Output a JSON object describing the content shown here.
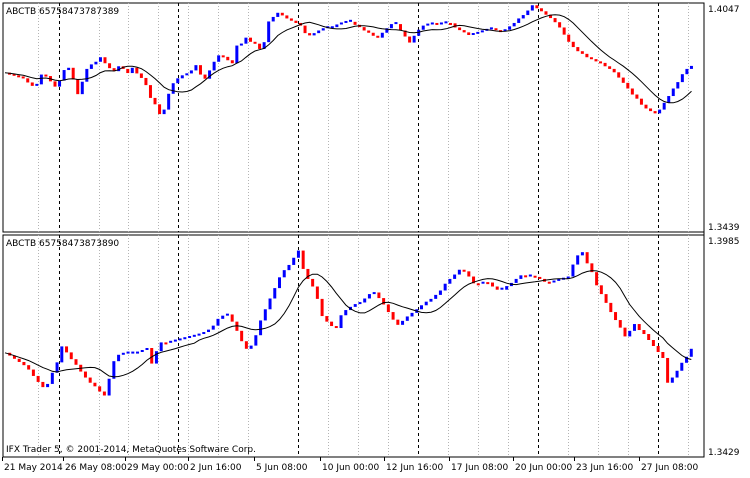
{
  "colors": {
    "up": "#0000ff",
    "down": "#ff0000",
    "line": "#000000",
    "grid": "#b4b4b4",
    "session": "#000000",
    "frame": "#000000",
    "background": "#ffffff"
  },
  "copyright": "IFX Trader 5, © 2001-2014, MetaQuotes Software Corp.",
  "x_axis": {
    "labels": [
      "21 May 2014",
      "26 May 08:00",
      "29 May 00:00",
      "2 Jun 16:00",
      "5 Jun 08:00",
      "10 Jun 00:00",
      "12 Jun 16:00",
      "17 Jun 08:00",
      "20 Jun 00:00",
      "23 Jun 16:00",
      "27 Jun 08:00"
    ]
  },
  "chart_data": [
    {
      "type": "line",
      "symbol": "ABCTB 65758473787389",
      "y_axis": {
        "top_label": "1.4047",
        "bottom_label": "1.3439",
        "ylim": [
          1.3439,
          1.4047
        ]
      },
      "series": [
        {
          "name": "",
          "role": "renko_close",
          "values": [
            1.3862,
            1.3859,
            1.3855,
            1.3852,
            1.3847,
            1.3836,
            1.3827,
            1.3831,
            1.3857,
            1.3853,
            1.3839,
            1.3825,
            1.3841,
            1.3869,
            1.3875,
            1.3844,
            1.3805,
            1.3838,
            1.3872,
            1.3884,
            1.3891,
            1.3903,
            1.3887,
            1.3874,
            1.3866,
            1.3879,
            1.3872,
            1.3861,
            1.3875,
            1.386,
            1.3848,
            1.3829,
            1.3795,
            1.3778,
            1.3752,
            1.3764,
            1.3806,
            1.3834,
            1.3847,
            1.3855,
            1.386,
            1.3868,
            1.3882,
            1.3857,
            1.3846,
            1.3868,
            1.3891,
            1.3908,
            1.3904,
            1.3895,
            1.3887,
            1.3934,
            1.3939,
            1.3955,
            1.3944,
            1.3939,
            1.3925,
            1.3943,
            1.3998,
            1.401,
            1.4021,
            1.4014,
            1.4006,
            1.4,
            1.3994,
            1.3987,
            1.3967,
            1.3961,
            1.3967,
            1.3974,
            1.398,
            1.398,
            1.3983,
            1.399,
            1.3994,
            1.3997,
            1.3997,
            1.3989,
            1.3983,
            1.3974,
            1.3968,
            1.396,
            1.3955,
            1.3968,
            1.398,
            1.3991,
            1.3991,
            1.3974,
            1.3958,
            1.3942,
            1.396,
            1.3976,
            1.3987,
            1.399,
            1.3994,
            1.399,
            1.3993,
            1.3994,
            1.3993,
            1.3982,
            1.3975,
            1.3969,
            1.3962,
            1.3965,
            1.3969,
            1.3973,
            1.3977,
            1.398,
            1.3975,
            1.3972,
            1.3976,
            1.3985,
            1.3994,
            1.4006,
            1.4015,
            1.4027,
            1.4041,
            1.4033,
            1.4025,
            1.4016,
            1.4007,
            1.3996,
            1.3982,
            1.3963,
            1.3944,
            1.393,
            1.3919,
            1.3912,
            1.3903,
            1.3898,
            1.3892,
            1.3888,
            1.3879,
            1.3872,
            1.3863,
            1.3849,
            1.3835,
            1.382,
            1.3804,
            1.3793,
            1.3777,
            1.3767,
            1.376,
            1.3754,
            1.3764,
            1.3782,
            1.38,
            1.382,
            1.3837,
            1.3858,
            1.3872,
            1.388
          ]
        },
        {
          "name": "",
          "role": "moving_average",
          "values": [
            1.3862,
            1.3859,
            1.3855,
            1.3852,
            1.3847,
            1.3836,
            1.3827,
            1.3831,
            1.3857,
            1.3853,
            1.3839,
            1.3825,
            1.3841,
            1.3869,
            1.3875,
            1.3844,
            1.3805,
            1.3838,
            1.3872,
            1.3884,
            1.3891,
            1.3903,
            1.3887,
            1.3874,
            1.3866,
            1.3879,
            1.3872,
            1.3861,
            1.3875,
            1.386,
            1.3848,
            1.3829,
            1.3795,
            1.3778,
            1.3752,
            1.3764,
            1.3806,
            1.3834,
            1.3847,
            1.3855,
            1.386,
            1.3868,
            1.3882,
            1.3857,
            1.3846,
            1.3868,
            1.3891,
            1.3908,
            1.3904,
            1.3895,
            1.3887,
            1.3934,
            1.3939,
            1.3955,
            1.3944,
            1.3939,
            1.3925,
            1.3943,
            1.3998,
            1.401,
            1.4021,
            1.4014,
            1.4006,
            1.4,
            1.3994,
            1.3987,
            1.3967,
            1.3961,
            1.3967,
            1.3974,
            1.398,
            1.398,
            1.3983,
            1.399,
            1.3994,
            1.3997,
            1.3997,
            1.3989,
            1.3983,
            1.3974,
            1.3968,
            1.396,
            1.3955,
            1.3968,
            1.398,
            1.3991,
            1.3991,
            1.3974,
            1.3958,
            1.3942,
            1.396,
            1.3976,
            1.3987,
            1.399,
            1.3994,
            1.399,
            1.3993,
            1.3994,
            1.3993,
            1.3982,
            1.3975,
            1.3969,
            1.3962,
            1.3965,
            1.3969,
            1.3973,
            1.3977,
            1.398,
            1.3975,
            1.3972,
            1.3976,
            1.3985,
            1.3994,
            1.4006,
            1.4015,
            1.4027,
            1.4041,
            1.4033,
            1.4025,
            1.4016,
            1.4007,
            1.3996,
            1.3982,
            1.3963,
            1.3944,
            1.393,
            1.3919,
            1.3912,
            1.3903,
            1.3898,
            1.3892,
            1.3888,
            1.3879,
            1.3872,
            1.3863,
            1.3849,
            1.3835,
            1.382,
            1.3804,
            1.3793,
            1.3777,
            1.3767,
            1.376,
            1.3754,
            1.3764,
            1.3782,
            1.38,
            1.382,
            1.3837,
            1.3858,
            1.3872,
            1.388
          ]
        }
      ]
    },
    {
      "type": "line",
      "symbol": "ABCTB 65758473873890",
      "y_axis": {
        "top_label": "1.3985",
        "bottom_label": "1.3429",
        "ylim": [
          1.3429,
          1.3985
        ]
      },
      "series": [
        {
          "name": "",
          "role": "renko_close",
          "values": [
            1.369,
            1.3683,
            1.3675,
            1.3667,
            1.3659,
            1.3648,
            1.3632,
            1.3617,
            1.3604,
            1.3612,
            1.364,
            1.3666,
            1.3706,
            1.3691,
            1.3674,
            1.366,
            1.3643,
            1.3628,
            1.3615,
            1.3606,
            1.3593,
            1.3583,
            1.3625,
            1.3669,
            1.3685,
            1.3688,
            1.3688,
            1.3688,
            1.3692,
            1.3697,
            1.3702,
            1.3663,
            1.3694,
            1.3716,
            1.3715,
            1.3718,
            1.3721,
            1.3724,
            1.3727,
            1.373,
            1.3733,
            1.3737,
            1.3742,
            1.3748,
            1.3758,
            1.3775,
            1.3783,
            1.3786,
            1.3768,
            1.3745,
            1.3719,
            1.37,
            1.3708,
            1.3734,
            1.3771,
            1.3799,
            1.3826,
            1.3852,
            1.3879,
            1.3897,
            1.391,
            1.3928,
            1.3946,
            1.39,
            1.3875,
            1.3856,
            1.3825,
            1.3782,
            1.3768,
            1.3757,
            1.3752,
            1.3784,
            1.3797,
            1.3805,
            1.3812,
            1.3816,
            1.3826,
            1.3837,
            1.3841,
            1.3827,
            1.3811,
            1.3792,
            1.3773,
            1.376,
            1.377,
            1.3781,
            1.379,
            1.3799,
            1.3809,
            1.3818,
            1.3825,
            1.3835,
            1.3846,
            1.3863,
            1.3875,
            1.3886,
            1.3898,
            1.3894,
            1.3881,
            1.3864,
            1.3863,
            1.3867,
            1.3866,
            1.3856,
            1.3848,
            1.3848,
            1.3857,
            1.3865,
            1.3875,
            1.3884,
            1.3881,
            1.3883,
            1.388,
            1.3875,
            1.3868,
            1.3866,
            1.387,
            1.3873,
            1.3876,
            1.3881,
            1.3911,
            1.3934,
            1.3942,
            1.3914,
            1.3892,
            1.3859,
            1.3837,
            1.3815,
            1.3792,
            1.3772,
            1.3753,
            1.3731,
            1.3745,
            1.3762,
            1.3747,
            1.3737,
            1.3722,
            1.3707,
            1.3692,
            1.3677,
            1.3615,
            1.3628,
            1.3645,
            1.3665,
            1.368,
            1.37
          ]
        },
        {
          "name": "",
          "role": "moving_average",
          "values": [
            1.369,
            1.3683,
            1.3675,
            1.3667,
            1.3659,
            1.3648,
            1.3632,
            1.3617,
            1.3604,
            1.3612,
            1.364,
            1.3666,
            1.3706,
            1.3691,
            1.3674,
            1.366,
            1.3643,
            1.3628,
            1.3615,
            1.3606,
            1.3593,
            1.3583,
            1.3625,
            1.3669,
            1.3685,
            1.3688,
            1.3688,
            1.3688,
            1.3692,
            1.3697,
            1.3702,
            1.3663,
            1.3694,
            1.3716,
            1.3715,
            1.3718,
            1.3721,
            1.3724,
            1.3727,
            1.373,
            1.3733,
            1.3737,
            1.3742,
            1.3748,
            1.3758,
            1.3775,
            1.3783,
            1.3786,
            1.3768,
            1.3745,
            1.3719,
            1.37,
            1.3708,
            1.3734,
            1.3771,
            1.3799,
            1.3826,
            1.3852,
            1.3879,
            1.3897,
            1.391,
            1.3928,
            1.3946,
            1.39,
            1.3875,
            1.3856,
            1.3825,
            1.3782,
            1.3768,
            1.3757,
            1.3752,
            1.3784,
            1.3797,
            1.3805,
            1.3812,
            1.3816,
            1.3826,
            1.3837,
            1.3841,
            1.3827,
            1.3811,
            1.3792,
            1.3773,
            1.376,
            1.377,
            1.3781,
            1.379,
            1.3799,
            1.3809,
            1.3818,
            1.3825,
            1.3835,
            1.3846,
            1.3863,
            1.3875,
            1.3886,
            1.3898,
            1.3894,
            1.3881,
            1.3864,
            1.3863,
            1.3867,
            1.3866,
            1.3856,
            1.3848,
            1.3848,
            1.3857,
            1.3865,
            1.3875,
            1.3884,
            1.3881,
            1.3883,
            1.388,
            1.3875,
            1.3868,
            1.3866,
            1.387,
            1.3873,
            1.3876,
            1.3881,
            1.3911,
            1.3934,
            1.3942,
            1.3914,
            1.3892,
            1.3859,
            1.3837,
            1.3815,
            1.3792,
            1.3772,
            1.3753,
            1.3731,
            1.3745,
            1.3762,
            1.3747,
            1.3737,
            1.3722,
            1.3707,
            1.3692,
            1.3677,
            1.3615,
            1.3628,
            1.3645,
            1.3665,
            1.368,
            1.37
          ]
        }
      ]
    }
  ]
}
